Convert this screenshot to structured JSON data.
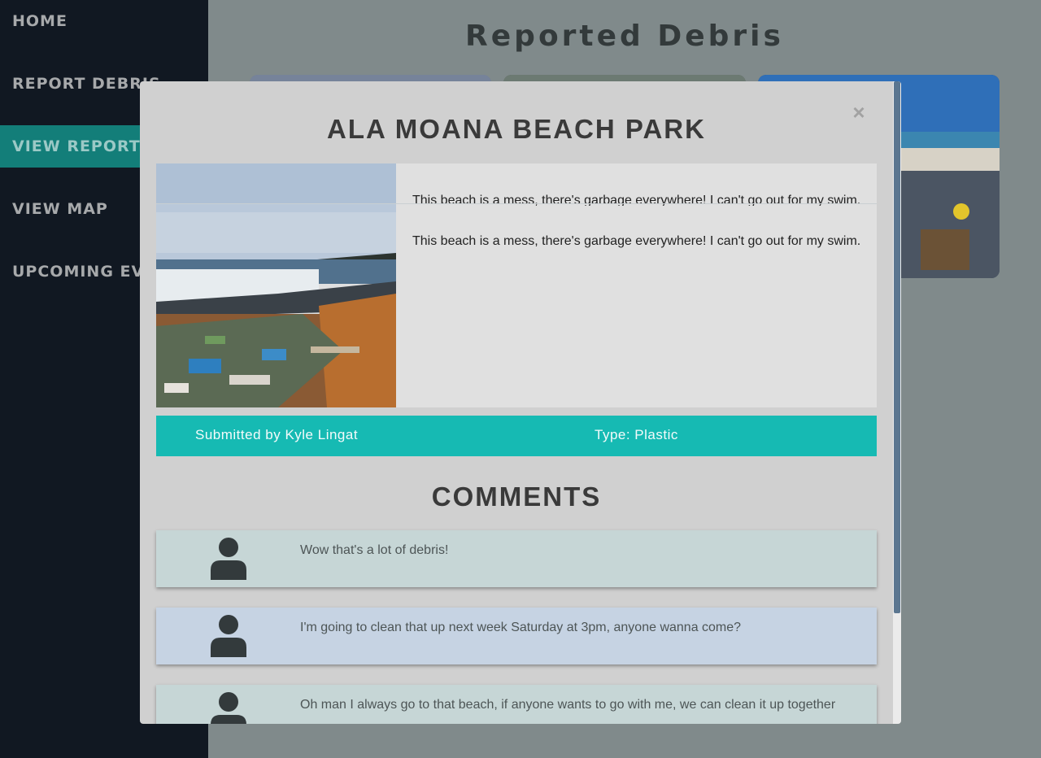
{
  "sidebar": {
    "items": [
      {
        "label": "HOME"
      },
      {
        "label": "REPORT DEBRIS"
      },
      {
        "label": "VIEW REPORTS"
      },
      {
        "label": "VIEW MAP"
      },
      {
        "label": "UPCOMING EVENTS"
      }
    ],
    "active_index": 2
  },
  "page": {
    "title": "Reported Debris"
  },
  "modal": {
    "close_symbol": "×",
    "title": "ALA MOANA BEACH PARK",
    "description": "This beach is a mess, there's garbage everywhere! I can't go out for my swim.",
    "submitted_by": "Submitted by Kyle Lingat",
    "type": "Type: Plastic",
    "comments_heading": "COMMENTS",
    "comments": [
      {
        "text": "Wow that's a lot of debris!",
        "avatar_icon": "user-icon"
      },
      {
        "text": "I'm going to clean that up next week Saturday at 3pm, anyone wanna come?",
        "avatar_icon": "user-icon"
      },
      {
        "text": "Oh man I always go to that beach, if anyone wants to go with me, we can clean it up together",
        "avatar_icon": "user-icon"
      }
    ]
  },
  "colors": {
    "sidebar_bg": "#111822",
    "active_nav": "#137e79",
    "meta_bar": "#16bab3",
    "modal_bg": "#d0d0d0",
    "scroll_thumb": "#5b7690"
  }
}
